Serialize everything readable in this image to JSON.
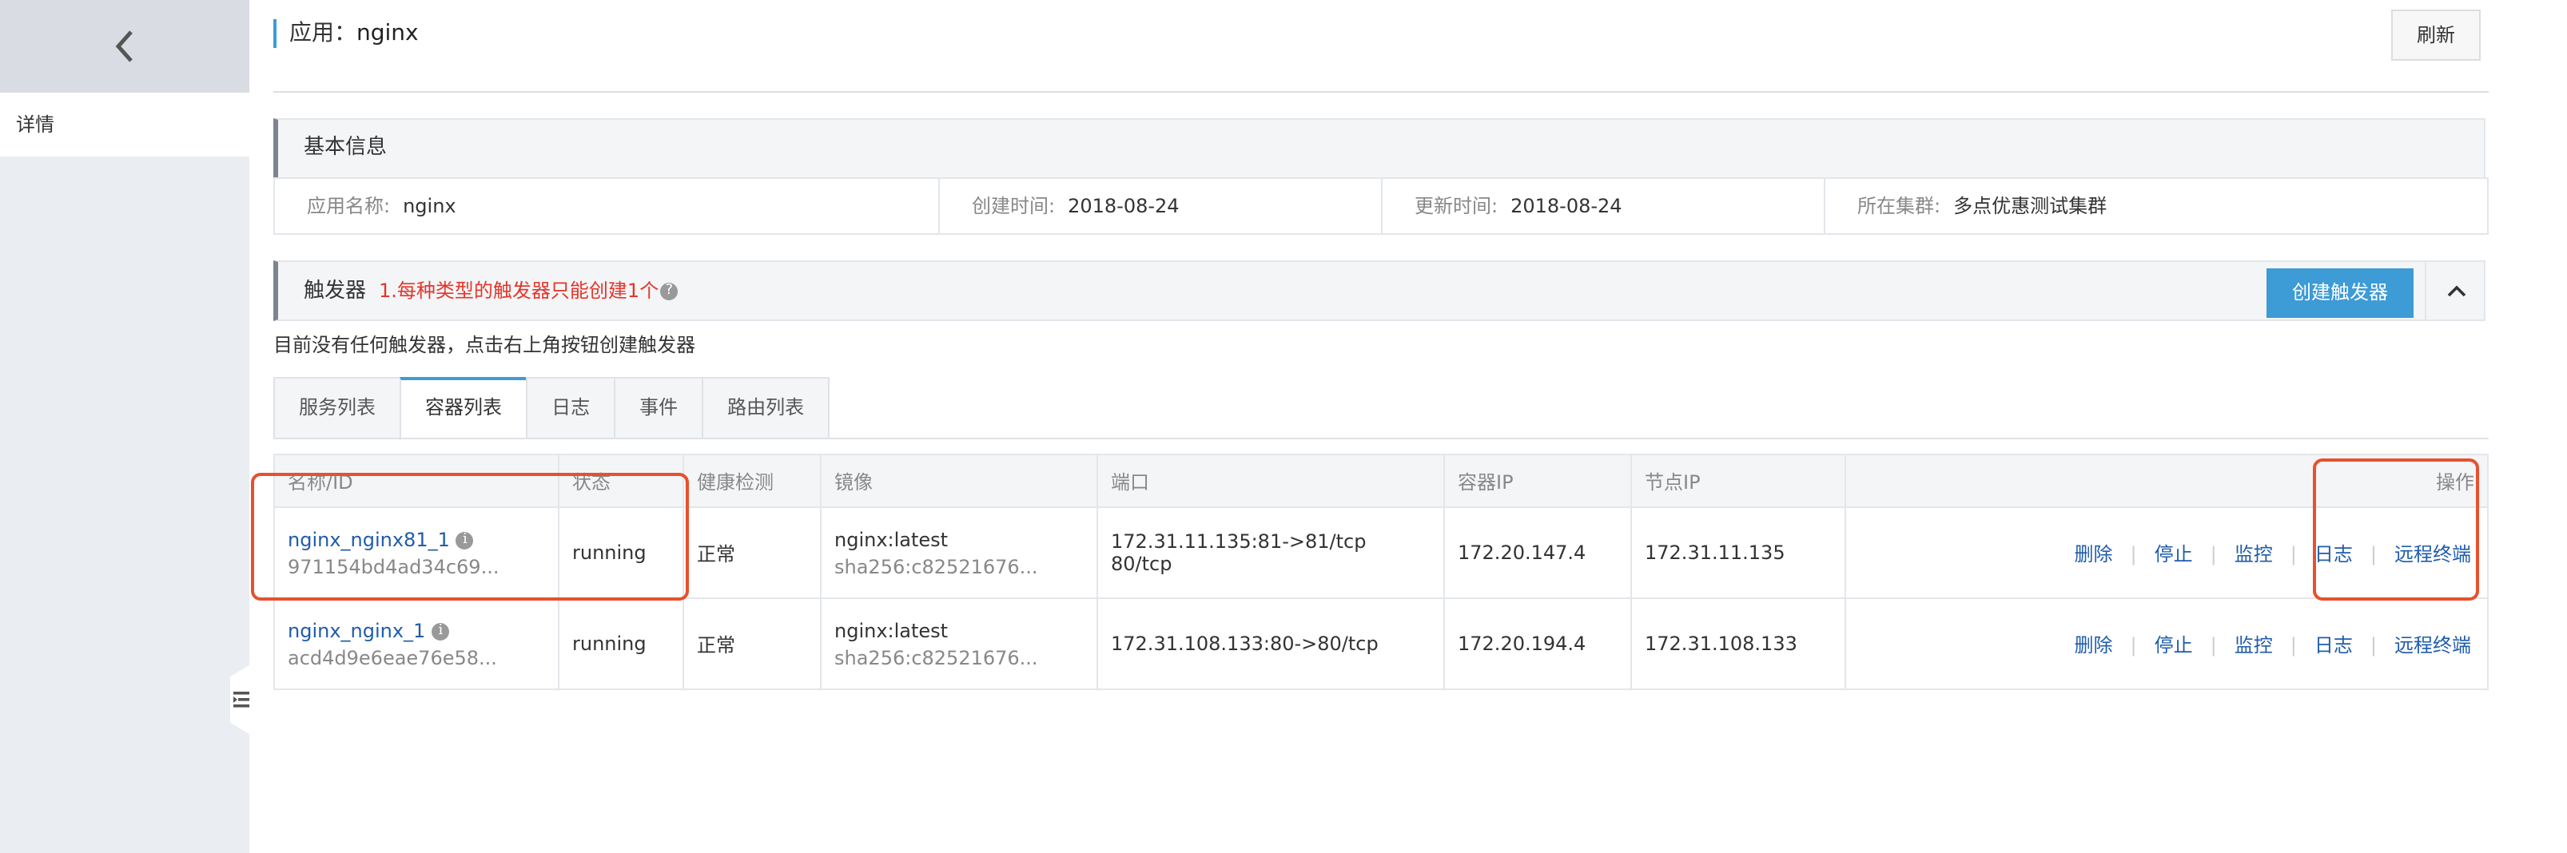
{
  "header": {
    "title_prefix": "应用：",
    "app_name": "nginx",
    "refresh_label": "刷新"
  },
  "sidebar": {
    "detail_label": "详情"
  },
  "basic_info": {
    "title": "基本信息",
    "app_name_label": "应用名称:",
    "app_name_value": "nginx",
    "created_label": "创建时间:",
    "created_value": "2018-08-24",
    "updated_label": "更新时间:",
    "updated_value": "2018-08-24",
    "cluster_label": "所在集群:",
    "cluster_value": "多点优惠测试集群"
  },
  "trigger": {
    "title": "触发器",
    "tip": "1.每种类型的触发器只能创建1个",
    "create_label": "创建触发器",
    "empty_text": "目前没有任何触发器，点击右上角按钮创建触发器"
  },
  "tabs": [
    {
      "label": "服务列表"
    },
    {
      "label": "容器列表"
    },
    {
      "label": "日志"
    },
    {
      "label": "事件"
    },
    {
      "label": "路由列表"
    }
  ],
  "table": {
    "headers": {
      "name": "名称/ID",
      "status": "状态",
      "health": "健康检测",
      "image": "镜像",
      "port": "端口",
      "container_ip": "容器IP",
      "node_ip": "节点IP",
      "ops": "操作"
    },
    "rows": [
      {
        "name": "nginx_nginx81_1",
        "id": "971154bd4ad34c69...",
        "status": "running",
        "health": "正常",
        "image": "nginx:latest",
        "image_sha": "sha256:c82521676...",
        "port_line1": "172.31.11.135:81->81/tcp",
        "port_line2": "80/tcp",
        "container_ip": "172.20.147.4",
        "node_ip": "172.31.11.135"
      },
      {
        "name": "nginx_nginx_1",
        "id": "acd4d9e6eae76e58...",
        "status": "running",
        "health": "正常",
        "image": "nginx:latest",
        "image_sha": "sha256:c82521676...",
        "port_line1": "172.31.108.133:80->80/tcp",
        "port_line2": "",
        "container_ip": "172.20.194.4",
        "node_ip": "172.31.108.133"
      }
    ],
    "actions": {
      "delete": "删除",
      "stop": "停止",
      "monitor": "监控",
      "log": "日志",
      "terminal": "远程终端"
    }
  },
  "colors": {
    "accent": "#3d9bd6",
    "link": "#1f5cac",
    "running": "#2f9e2f",
    "annotation": "#e6512e",
    "tip": "#e4362b"
  }
}
